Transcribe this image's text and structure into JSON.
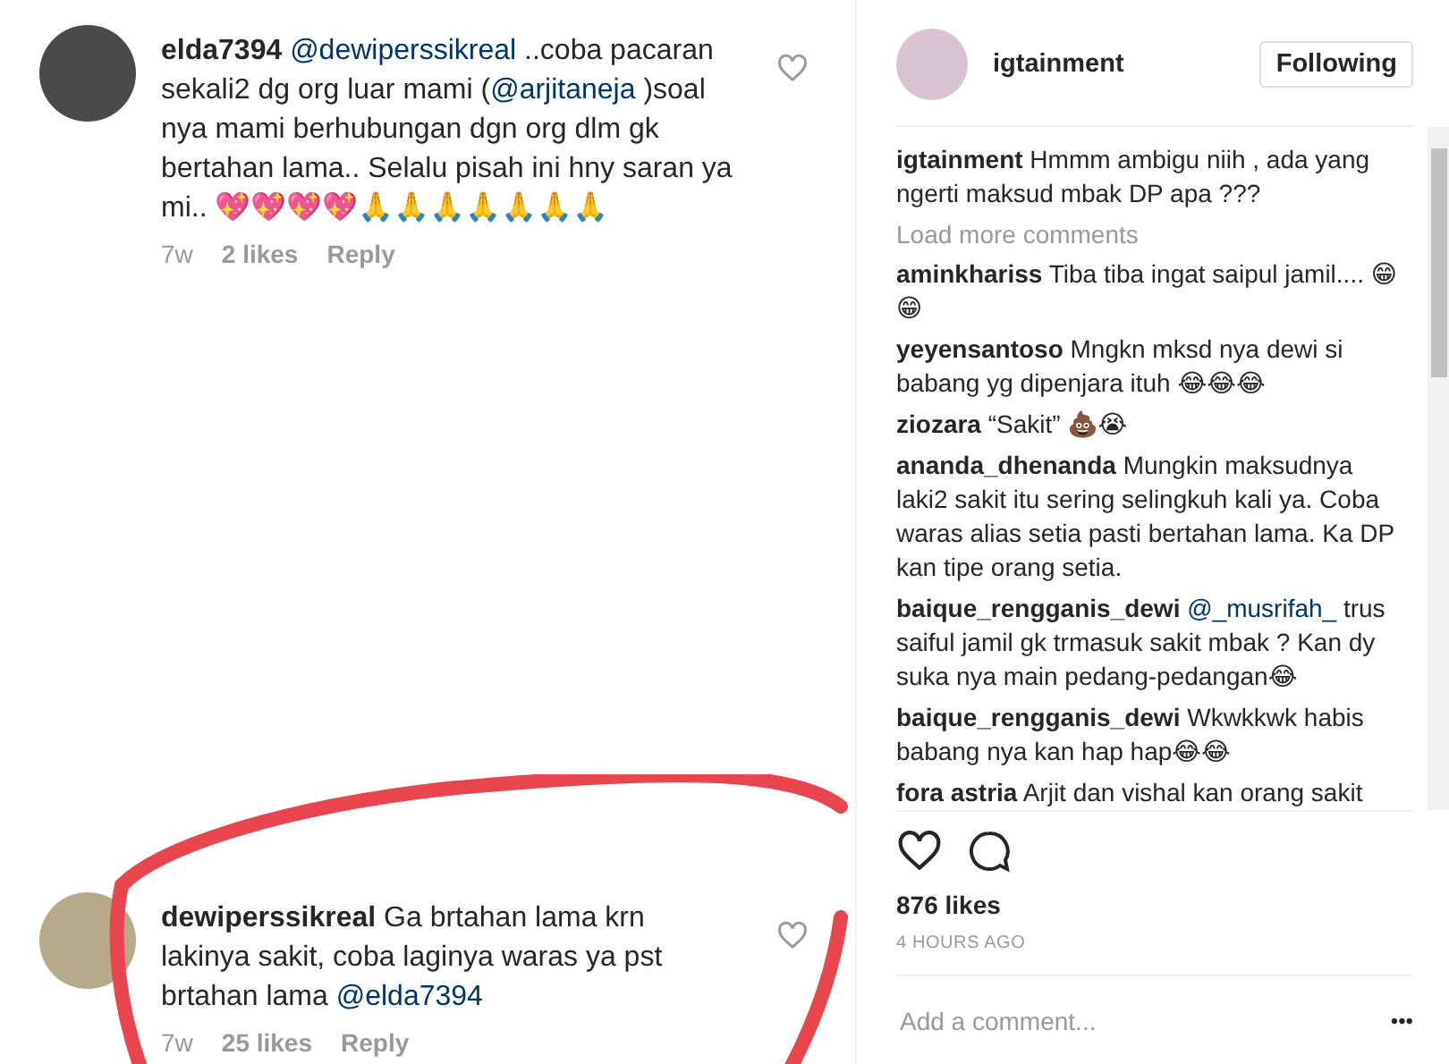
{
  "left_comments": [
    {
      "user": "elda7394",
      "parts": [
        {
          "kind": "mention",
          "text": "@dewiperssikreal"
        },
        {
          "kind": "text",
          "text": " ..coba pacaran sekali2 dg org luar mami ("
        },
        {
          "kind": "mention",
          "text": "@arjitaneja"
        },
        {
          "kind": "text",
          "text": " )soal nya mami berhubungan dgn org dlm gk bertahan lama.. Selalu pisah ini hny saran ya mi.. 💖💖💖💖🙏🙏🙏🙏🙏🙏🙏"
        }
      ],
      "age": "7w",
      "likes": "2 likes",
      "reply": "Reply",
      "circled": false
    },
    {
      "user": "dewiperssikreal",
      "parts": [
        {
          "kind": "text",
          "text": "Ga brtahan lama krn lakinya sakit, coba laginya waras ya pst brtahan lama "
        },
        {
          "kind": "mention",
          "text": "@elda7394"
        }
      ],
      "age": "7w",
      "likes": "25 likes",
      "reply": "Reply",
      "circled": true
    }
  ],
  "post": {
    "account": "igtainment",
    "follow_button": "Following",
    "comments": [
      {
        "user": "igtainment",
        "parts": [
          {
            "kind": "text",
            "text": "Hmmm ambigu niih , ada yang ngerti maksud mbak DP apa ???"
          }
        ]
      },
      {
        "kind": "load_more",
        "text": "Load more comments"
      },
      {
        "user": "aminkhariss",
        "parts": [
          {
            "kind": "text",
            "text": "Tiba tiba ingat saipul jamil.... 😁😁"
          }
        ]
      },
      {
        "user": "yeyensantoso",
        "parts": [
          {
            "kind": "text",
            "text": "Mngkn mksd nya dewi si babang yg dipenjara ituh 😂😂😂"
          }
        ]
      },
      {
        "user": "ziozara",
        "parts": [
          {
            "kind": "text",
            "text": "“Sakit” 💩😭"
          }
        ]
      },
      {
        "user": "ananda_dhenanda",
        "parts": [
          {
            "kind": "text",
            "text": "Mungkin maksudnya laki2 sakit itu sering selingkuh kali ya. Coba waras alias setia pasti bertahan lama. Ka DP kan tipe orang setia."
          }
        ]
      },
      {
        "user": "baique_rengganis_dewi",
        "parts": [
          {
            "kind": "mention",
            "text": "@_musrifah_"
          },
          {
            "kind": "text",
            "text": " trus saiful jamil gk trmasuk sakit mbak ? Kan dy suka nya main pedang-pedangan😂"
          }
        ]
      },
      {
        "user": "baique_rengganis_dewi",
        "parts": [
          {
            "kind": "text",
            "text": "Wkwkkwk habis babang nya kan hap hap😂😂"
          }
        ]
      },
      {
        "user": "fora astria",
        "parts": [
          {
            "kind": "text",
            "text": "Arjit dan vishal kan orang sakit"
          }
        ]
      }
    ],
    "likes": "876 likes",
    "time": "4 HOURS AGO",
    "comment_placeholder": "Add a comment...",
    "more": "•••"
  }
}
